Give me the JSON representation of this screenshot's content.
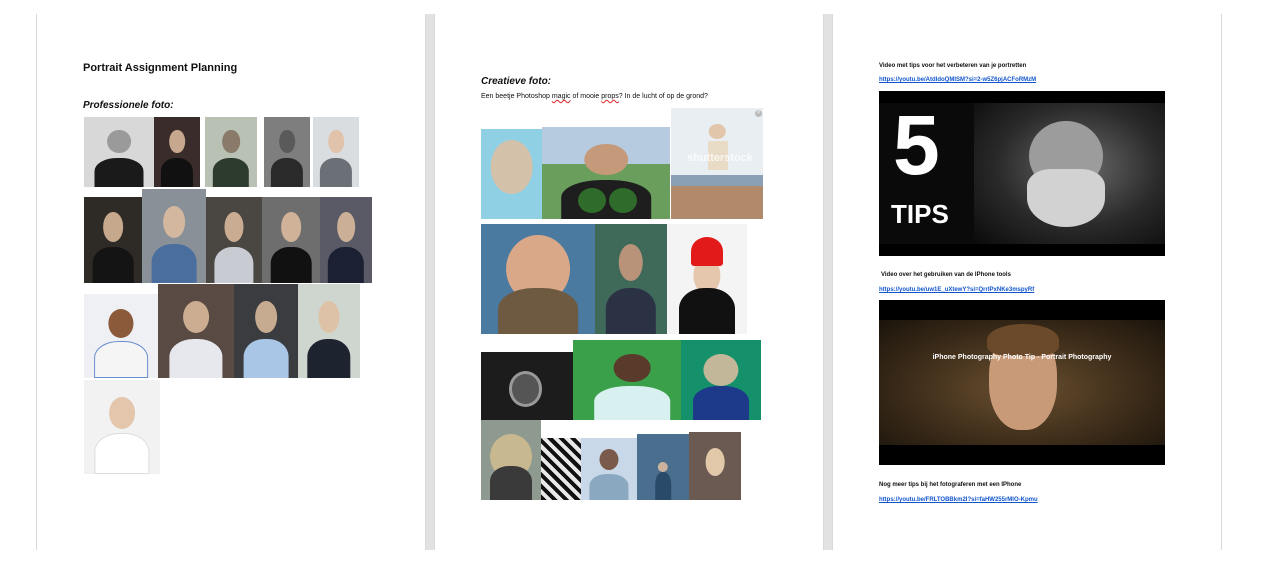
{
  "page1": {
    "title": "Portrait Assignment Planning",
    "section_heading": "Professionele foto:"
  },
  "page2": {
    "section_heading": "Creatieve foto:",
    "description_before": "Een beetje Photoshop ",
    "description_word1": "magic",
    "description_mid": " of mooie ",
    "description_word2": "props",
    "description_after": "? In de lucht of op de grond?",
    "watermark": "shutterstock",
    "close_glyph": "×"
  },
  "page3": {
    "video1_caption": "Video met tips voor het verbeteren van je portretten",
    "video1_link": "https://youtu.be/AtdIdoQMISM?si=2-w5Z6pjACFoRMzM",
    "video1_overlay_number": "5",
    "video1_overlay_text": "TIPS",
    "video2_caption": "Video over het gebruiken van de IPhone tools",
    "video2_link": "https://youtu.be/uw1E_uXtewY?si=QrrIPxNKe3mspyRf",
    "video2_overlay_text": "iPhone Photography Photo Tip - Portrait Photography",
    "video3_caption": "Nog meer tips bij het fotograferen met een IPhone",
    "video3_link": "https://youtu.be/FRLTOBBkm2I?si=faHW255rMIO-Kpmu"
  },
  "colors": {
    "link": "#1155cc",
    "page_gutter": "#e2e2e2"
  }
}
